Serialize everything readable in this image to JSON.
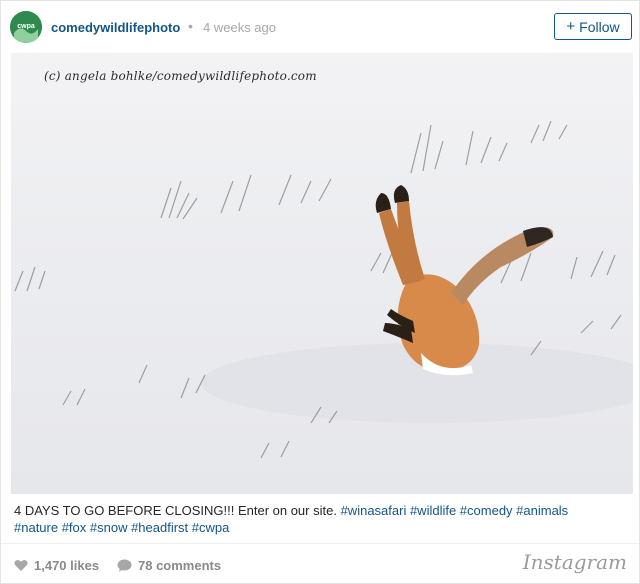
{
  "post": {
    "username": "comedywildlifephoto",
    "separator": "•",
    "time_ago": "4 weeks ago",
    "follow_label": "Follow",
    "follow_plus": "+"
  },
  "photo": {
    "watermark": "(c) angela bohlke/comedywildlifephoto.com"
  },
  "caption": {
    "text": "4 DAYS TO GO BEFORE CLOSING!!! Enter on our site.",
    "hashtags_line1": "#winasafari #wildlife #comedy #animals",
    "hashtags_line2": "#nature #fox #snow #headfirst #cwpa"
  },
  "footer": {
    "likes": "1,470 likes",
    "comments": "78 comments",
    "brand": "Instagram"
  },
  "icons": {
    "heart": "heart-icon",
    "comment": "comment-bubble-icon",
    "avatar": "avatar-logo"
  },
  "colors": {
    "link": "#125688",
    "muted": "#a5a7aa",
    "text": "#262626"
  }
}
